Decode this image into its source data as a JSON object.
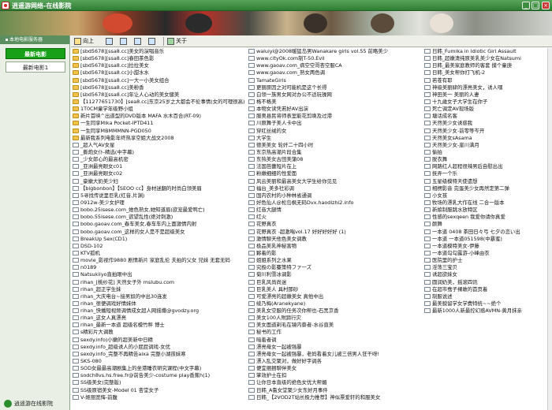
{
  "window": {
    "title": "逍遥游网络-在线影院",
    "minimize_label": "_",
    "maximize_label": "□",
    "close_label": "×"
  },
  "sidebar": {
    "header": "本地电影服务器",
    "items": [
      {
        "label": "最新电影"
      },
      {
        "label": "最新电影1"
      }
    ],
    "footer": "逍遥游在线影院"
  },
  "toolbar": {
    "up_label": "向上",
    "view1": "",
    "view2": "",
    "view3": "",
    "view4": "",
    "about_label": "关于"
  },
  "columns": [
    {
      "items": [
        {
          "t": "folder",
          "label": "[sbd5678][ssa8.cc]美女的演唱音乐"
        },
        {
          "t": "folder",
          "label": "[sbd5678][ssa8.cc]春田茶色影"
        },
        {
          "t": "folder",
          "label": "[sbd5678][ssa8.cc]拉拉美女"
        },
        {
          "t": "folder",
          "label": "[sbd5678][ssa8.cc]小甜水水"
        },
        {
          "t": "folder",
          "label": "[sbd5678][ssa8.cc]一大一小美女组合"
        },
        {
          "t": "folder",
          "label": "[sbd5678][ssa8.cc]美粉香"
        },
        {
          "t": "folder",
          "label": "[sbd5678][ssa8.cc]年让人心动的美女健美"
        },
        {
          "t": "folder",
          "label": "【11277651730】[sea8.cc]东京25岁之大都会不伦事情(女的可理很高)"
        },
        {
          "t": "folder",
          "label": "1T0CM童学年级野小组"
        },
        {
          "t": "folder",
          "label": "新片首映^出道型的DVD版本  MAFA 水木百合(RT-09)"
        },
        {
          "t": "folder",
          "label": "一生同享Mika Pocket-IPTD411"
        },
        {
          "t": "folder",
          "label": "一生同享MBMMMNN-PGD050"
        },
        {
          "t": "folder",
          "label": "最新我系列电影年终热享空姐大战文2008"
        },
        {
          "t": "file",
          "label": "_超人气AV女星"
        },
        {
          "t": "file",
          "label": "_撕炮女仆-精选(中字幕)"
        },
        {
          "t": "file",
          "label": "_少女郎心的最高机密"
        },
        {
          "t": "file",
          "label": "_亚洲最亮眼女c01"
        },
        {
          "t": "file",
          "label": "_亚洲最亮眼女c02"
        },
        {
          "t": "file",
          "label": "_豪嫩大奶美少妇"
        },
        {
          "t": "file",
          "label": "【bigbonbon】【SEOO cc】身材迷翻的时尚白领美眉"
        },
        {
          "t": "file",
          "label": "5寻找传说里巨乳(红音,片渊)"
        },
        {
          "t": "file",
          "label": "0912w-美少女护理"
        },
        {
          "t": "file",
          "label": "bobo.25isese.com_她色熟女,她知道眉(欲宠最爱鸭亡)"
        },
        {
          "t": "file",
          "label": "bobo.55isese.com_欲望乱性(绝对刺激)"
        },
        {
          "t": "file",
          "label": "bobo.gaoav.com_春车美女,春车车内上面激情内射"
        },
        {
          "t": "file",
          "label": "bobo.gaoav.com_这样的女人是不是超级美女"
        },
        {
          "t": "file",
          "label": "BreakUp Sex(CD1)"
        },
        {
          "t": "file",
          "label": "DSD-102"
        },
        {
          "t": "file",
          "label": "KTV孤机"
        },
        {
          "t": "file",
          "label": "movie_影视作9880 剧情新片 家庭乱伦 夫拍的父女 兄妹 无套无码"
        },
        {
          "t": "file",
          "label": "n0189"
        },
        {
          "t": "file",
          "label": "Natsukiiyo直拍眼中出"
        },
        {
          "t": "file",
          "label": "rihan_[桃纱花] 天然女子外 mslubu.com"
        },
        {
          "t": "file",
          "label": "rihan_超正学生妹"
        },
        {
          "t": "file",
          "label": "rihan_大庆电台~接男奴的中出30连发"
        },
        {
          "t": "file",
          "label": "rihan_很便调戏好情妹体"
        },
        {
          "t": "file",
          "label": "rihan_快播短视频调情成女超人网摇撒@gvodzy.org"
        },
        {
          "t": "file",
          "label": "rihan_这女人真漂亮"
        },
        {
          "t": "file",
          "label": "rihan_最新一本道 超级名模竹秤 博士"
        },
        {
          "t": "file",
          "label": "s精彩片大调教"
        },
        {
          "t": "file",
          "label": "sexdy.info)小嫩的超美新中日精"
        },
        {
          "t": "file",
          "label": "sexdy.info_超级诱人的小屁屁调戏-女优"
        },
        {
          "t": "file",
          "label": "sexdy.info_完整不再精告aixa 完整小湖孩妹寒"
        },
        {
          "t": "file",
          "label": "SKS-080"
        },
        {
          "t": "file",
          "label": "SOD女最最高潮剧集上的坐港睡衣研究课程(中文字幕)"
        },
        {
          "t": "file",
          "label": "sodch8vs.hs.free.fr@前告美少-costume play香蕉h(1)"
        },
        {
          "t": "file",
          "label": "SS级美女(完整版)"
        },
        {
          "t": "file",
          "label": "SS级原宿美女-Model 01 杏堂女子"
        },
        {
          "t": "file",
          "label": "V-姬丽宽悔-前腹"
        }
      ]
    },
    {
      "items": [
        {
          "t": "file",
          "label": "waluiyi@2008暖猛岛男Wanakare girls vol.55 前略美少"
        },
        {
          "t": "file",
          "label": "www.cityOk.com制T-50.Evil"
        },
        {
          "t": "file",
          "label": "www.gaoav.com_病空空哥杏空服CA"
        },
        {
          "t": "file",
          "label": "www.gaoav.com_熟女两色调"
        },
        {
          "t": "file",
          "label": "TamateGirls"
        },
        {
          "t": "file",
          "label": "更丽原因之对可能机是这个长得"
        },
        {
          "t": "file",
          "label": "白领一族男女网对办公不适玩操网"
        },
        {
          "t": "file",
          "label": "格不格美"
        },
        {
          "t": "file",
          "label": "本物女读凭若好AV出演"
        },
        {
          "t": "file",
          "label": "服奥县民将师表室能花剪唤及过港"
        },
        {
          "t": "file",
          "label": "川原舞子美人卡中出"
        },
        {
          "t": "file",
          "label": "穿红丝绒的女"
        },
        {
          "t": "file",
          "label": "大学生"
        },
        {
          "t": "file",
          "label": "德美美女 轮奸二十四小时"
        },
        {
          "t": "file",
          "label": "东京热高潮片段合集"
        },
        {
          "t": "file",
          "label": "东热美女古田美蒲08"
        },
        {
          "t": "file",
          "label": "法国芭蕾短片在上"
        },
        {
          "t": "file",
          "label": "粉嫩细细的性爱面"
        },
        {
          "t": "file",
          "label": "风云美丽和最高美女大学生给你见见"
        },
        {
          "t": "file",
          "label": "福台_美多社彩调"
        },
        {
          "t": "file",
          "label": "国内农村的小种林省通调"
        },
        {
          "t": "file",
          "label": "好色仙人@松岛枫无码Dvx.haodizhi2.info"
        },
        {
          "t": "file",
          "label": "红音大腿情"
        },
        {
          "t": "file",
          "label": "红火"
        },
        {
          "t": "file",
          "label": "花野真衣"
        },
        {
          "t": "file",
          "label": "花野真衣 -超激喘vol.17 好好好好好 (1)"
        },
        {
          "t": "file",
          "label": "激情聊天他色美女调教"
        },
        {
          "t": "file",
          "label": "极品美乳神秘害物"
        },
        {
          "t": "file",
          "label": "夥着的影"
        },
        {
          "t": "file",
          "label": "姐姐系列之水果"
        },
        {
          "t": "file",
          "label": "究极の影蹇策特ファーズ"
        },
        {
          "t": "file",
          "label": "菊川利雪冰调影"
        },
        {
          "t": "file",
          "label": "巨乳风尚尚迷"
        },
        {
          "t": "file",
          "label": "巨乳美人 具村那砂"
        },
        {
          "t": "file",
          "label": "可爱漂亮的超嫩美女 真他中出"
        },
        {
          "t": "file",
          "label": "绫乃梅(Aranekyane)"
        },
        {
          "t": "file",
          "label": "美乳女空服的任务次你帮也-石黑京香"
        },
        {
          "t": "file",
          "label": "美女100人附蹄行灾"
        },
        {
          "t": "file",
          "label": "美女面道剃毛在镜内蔡者-水谷直美"
        },
        {
          "t": "file",
          "label": "秘书的工作"
        },
        {
          "t": "file",
          "label": "暗羞者调"
        },
        {
          "t": "file",
          "label": "漂亮母女一起被强暴"
        },
        {
          "t": "file",
          "label": "漂亮母女一起被强暴，老妈看着女儿被三倍男人狂干呀!"
        },
        {
          "t": "file",
          "label": "漂入乱交聚对，做好好字调各"
        },
        {
          "t": "file",
          "label": "便宜捆捆聊伴美女"
        },
        {
          "t": "file",
          "label": "掌效护士在扣"
        },
        {
          "t": "file",
          "label": "让你日本直级的绝色女优大帮媚"
        },
        {
          "t": "file",
          "label": "日韩_A鲁女堂聚少女东好月事件"
        },
        {
          "t": "file",
          "label": "日韩_【2VOD2T站长极力推荐】神似票爱轩的和服美女"
        }
      ]
    },
    {
      "items": [
        {
          "t": "file",
          "label": "日韩_Fumika in Idiotic Girl Assault"
        },
        {
          "t": "file",
          "label": "日韩_超嫩清纯原美乳美少女在Natsumi"
        },
        {
          "t": "file",
          "label": "日韩_最美家庭教师的客套 摸个童庚"
        },
        {
          "t": "file",
          "label": "日韩_美女帮你打飞机-2"
        },
        {
          "t": "file",
          "label": "若苍有耶"
        },
        {
          "t": "file",
          "label": "神级美丽肆的漂亮美女，诱人嘿"
        },
        {
          "t": "file",
          "label": "神田美一 美丽的人妻"
        },
        {
          "t": "file",
          "label": "十九歳女子大学生在你子"
        },
        {
          "t": "file",
          "label": "死亡调定AV现场版"
        },
        {
          "t": "file",
          "label": "塘话成名客"
        },
        {
          "t": "file",
          "label": "天然美少女诱惑我"
        },
        {
          "t": "file",
          "label": "天然美少女-前零等岑开"
        },
        {
          "t": "file",
          "label": "天然美女sAsama"
        },
        {
          "t": "file",
          "label": "天然美少女-崖川满月"
        },
        {
          "t": "file",
          "label": "偷拍"
        },
        {
          "t": "file",
          "label": "脱衣舞"
        },
        {
          "t": "file",
          "label": "网路红人超程很辣男后自慰出出"
        },
        {
          "t": "file",
          "label": "抚弄一个乐"
        },
        {
          "t": "file",
          "label": "五星级模特天使遗想"
        },
        {
          "t": "file",
          "label": "相楞影音 完蛋美少女再然定第二弹"
        },
        {
          "t": "file",
          "label": "小女孩"
        },
        {
          "t": "file",
          "label": "牧场的漂乳大作在线 二合一版本"
        },
        {
          "t": "file",
          "label": "新娘制服跳水放特区"
        },
        {
          "t": "file",
          "label": "性感的sexqeen 我爱你请你真爱"
        },
        {
          "t": "file",
          "label": "颜舞"
        },
        {
          "t": "file",
          "label": "一本道 0408 茶田日々弓 七夕の恋い出"
        },
        {
          "t": "file",
          "label": "一本道 一本道051598(中暴蜜)"
        },
        {
          "t": "file",
          "label": "一本道模特美女-伊藤"
        },
        {
          "t": "file",
          "label": "一本道勾勾露游-小峰由衣"
        },
        {
          "t": "file",
          "label": "医院里的护士"
        },
        {
          "t": "file",
          "label": "淫荡三宝贝"
        },
        {
          "t": "file",
          "label": "诱超欲妹女"
        },
        {
          "t": "file",
          "label": "圆润奶美，摇滚四讯"
        },
        {
          "t": "file",
          "label": "在超市鸯子裸敢的首页着"
        },
        {
          "t": "file",
          "label": "制服说述"
        },
        {
          "t": "file",
          "label": "最美貌留学女学费特统~~绝个"
        },
        {
          "t": "file",
          "label": "最新1000人新最控幻惑AVMN-黄月抹亲"
        }
      ]
    }
  ]
}
